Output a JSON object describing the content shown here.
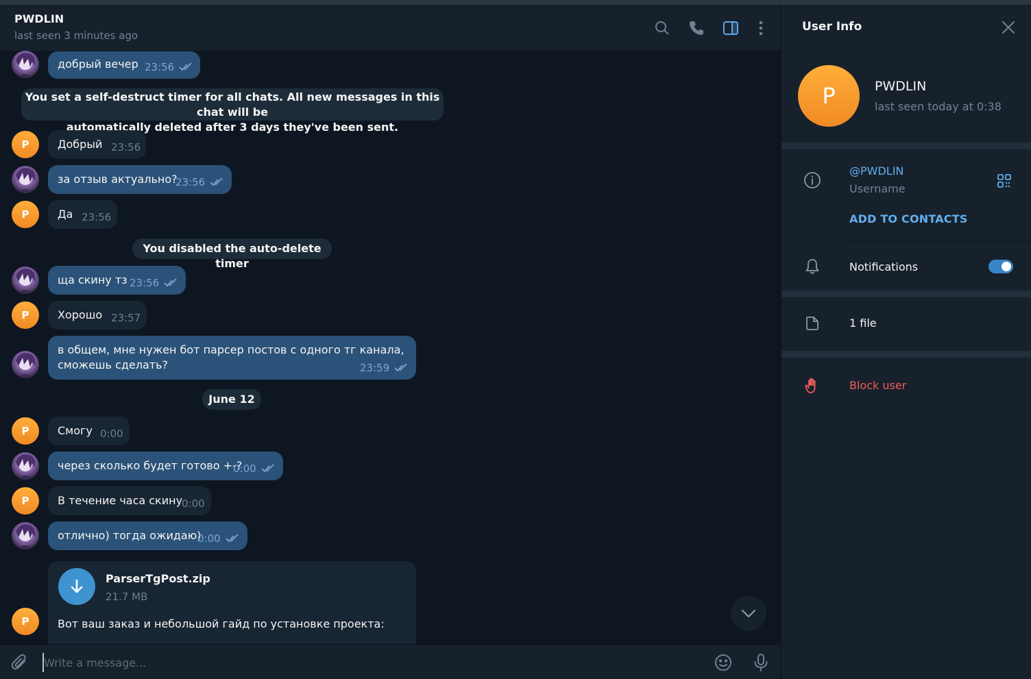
{
  "header": {
    "title": "PWDLIN",
    "status": "last seen 3 minutes ago",
    "icons": [
      "search-icon",
      "phone-icon",
      "sidebar-toggle-icon",
      "more-vertical-icon"
    ]
  },
  "messages": [
    {
      "from": "me",
      "text": "добрый вечер",
      "time": "23:56"
    },
    {
      "type": "service",
      "text_line1": "You set a self-destruct timer for all chats. All new messages in this chat will be",
      "text_line2": "automatically deleted after 3 days they've been sent."
    },
    {
      "from": "them",
      "text": "Добрый",
      "time": "23:56"
    },
    {
      "from": "me",
      "text": "за отзыв актуально?",
      "time": "23:56"
    },
    {
      "from": "them",
      "text": "Да",
      "time": "23:56"
    },
    {
      "type": "service",
      "text": "You disabled the auto-delete timer"
    },
    {
      "from": "me",
      "text": "ща скину тз",
      "time": "23:56"
    },
    {
      "from": "them",
      "text": "Хорошо",
      "time": "23:57"
    },
    {
      "from": "me",
      "text_line1": "в общем, мне нужен бот парсер постов с одного тг канала,",
      "text_line2": "сможешь сделать?",
      "time": "23:59"
    },
    {
      "type": "date",
      "text": "June 12"
    },
    {
      "from": "them",
      "text": "Смогу",
      "time": "0:00"
    },
    {
      "from": "me",
      "text": "через сколько будет готово +-?",
      "time": "0:00"
    },
    {
      "from": "them",
      "text": "В течение часа скину",
      "time": "0:00"
    },
    {
      "from": "me",
      "text": "отлично) тогда ожидаю)",
      "time": "0:00"
    },
    {
      "from": "them",
      "file_name": "ParserTgPost.zip",
      "file_size": "21.7 MB",
      "caption": "Вот ваш заказ и небольшой гайд по установке проекта:"
    }
  ],
  "avatar_initial": "P",
  "composer": {
    "placeholder": "Write a message...",
    "value": "",
    "icons": [
      "attach-icon",
      "emoji-icon",
      "microphone-icon"
    ]
  },
  "panel": {
    "title": "User Info",
    "avatar_initial": "P",
    "name": "PWDLIN",
    "last_seen": "last seen today at 0:38",
    "username": "@PWDLIN",
    "username_label": "Username",
    "add_contacts": "ADD TO CONTACTS",
    "notifications_label": "Notifications",
    "notifications_on": true,
    "files_label": "1 file",
    "block_label": "Block user"
  },
  "colors": {
    "background": "#0e1621",
    "header": "#17212b",
    "incoming_bubble": "#182533",
    "outgoing_bubble": "#2b5278",
    "accent": "#62aeef",
    "danger": "#ef5b5b",
    "avatar": "#f59a2e"
  }
}
